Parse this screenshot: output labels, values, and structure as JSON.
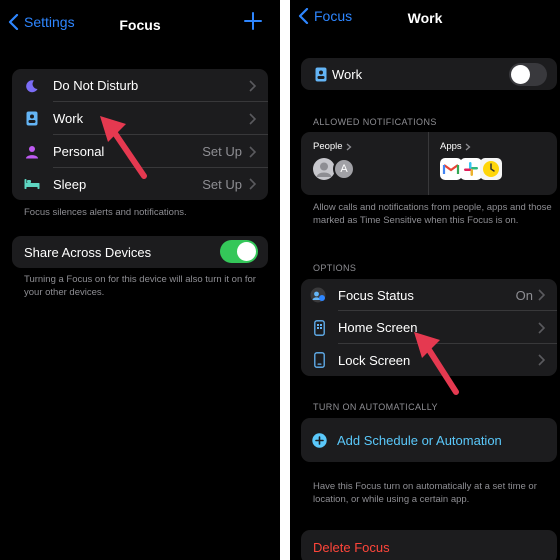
{
  "colors": {
    "accent": "#2e86ff",
    "toggle_on": "#34c759",
    "toggle_off": "#39393d",
    "destructive": "#ff453a",
    "annotation_arrow": "#e53950",
    "cell_bg": "#1c1c1e"
  },
  "left": {
    "nav": {
      "back_label": "Settings",
      "title": "Focus"
    },
    "focus_list": [
      {
        "label": "Do Not Disturb",
        "value": "",
        "icon": "moon-icon"
      },
      {
        "label": "Work",
        "value": "",
        "icon": "work-badge-icon"
      },
      {
        "label": "Personal",
        "value": "Set Up",
        "icon": "person-icon"
      },
      {
        "label": "Sleep",
        "value": "Set Up",
        "icon": "bed-icon"
      }
    ],
    "focus_footer": "Focus silences alerts and notifications.",
    "share": {
      "label": "Share Across Devices",
      "on": true
    },
    "share_footer": "Turning a Focus on for this device will also turn it on for your other devices."
  },
  "right": {
    "nav": {
      "back_label": "Focus",
      "title": "Work"
    },
    "work_toggle": {
      "label": "Work",
      "on": false
    },
    "allowed_header": "ALLOWED NOTIFICATIONS",
    "people_label": "People",
    "people_avatar_letter": "A",
    "apps_label": "Apps",
    "allowed_footer": "Allow calls and notifications from people, apps and those marked as Time Sensitive when this Focus is on.",
    "options_header": "OPTIONS",
    "options": [
      {
        "label": "Focus Status",
        "value": "On",
        "icon": "focus-status-icon"
      },
      {
        "label": "Home Screen",
        "value": "",
        "icon": "phone-home-icon"
      },
      {
        "label": "Lock Screen",
        "value": "",
        "icon": "phone-lock-icon"
      }
    ],
    "auto_header": "TURN ON AUTOMATICALLY",
    "add_schedule": "Add Schedule or Automation",
    "auto_footer": "Have this Focus turn on automatically at a set time or location, or while using a certain app.",
    "delete_label": "Delete Focus"
  }
}
